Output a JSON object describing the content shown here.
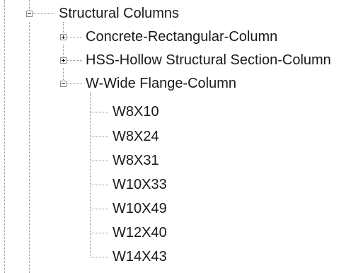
{
  "tree": {
    "root": {
      "label": "Structural Columns",
      "expanded": true,
      "children": [
        {
          "label": "Concrete-Rectangular-Column",
          "expanded": false
        },
        {
          "label": "HSS-Hollow Structural Section-Column",
          "expanded": false
        },
        {
          "label": "W-Wide Flange-Column",
          "expanded": true,
          "children": [
            {
              "label": "W8X10"
            },
            {
              "label": "W8X24"
            },
            {
              "label": "W8X31"
            },
            {
              "label": "W10X33"
            },
            {
              "label": "W10X49"
            },
            {
              "label": "W12X40"
            },
            {
              "label": "W14X43"
            }
          ]
        }
      ]
    }
  }
}
